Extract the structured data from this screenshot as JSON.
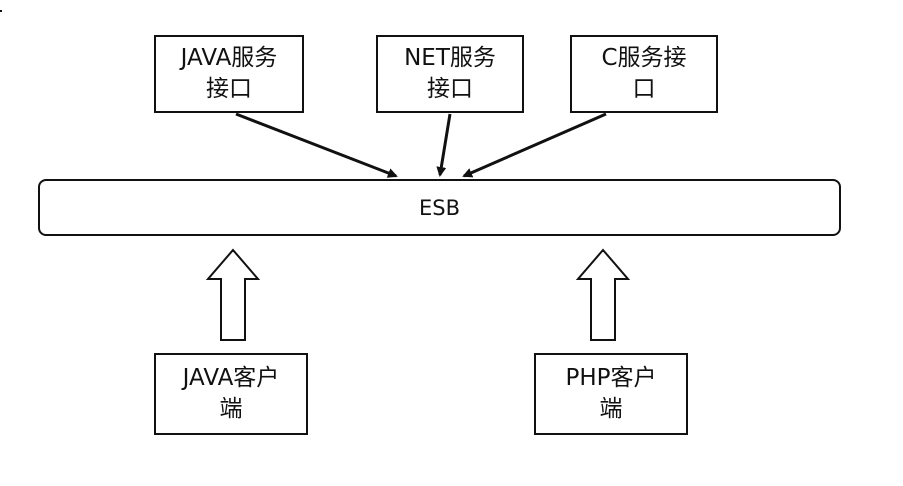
{
  "services": {
    "java": [
      "JAVA服务",
      "接口"
    ],
    "net": [
      "NET服务",
      "接口"
    ],
    "c": [
      "C服务接",
      "口"
    ]
  },
  "bus": {
    "label": "ESB"
  },
  "clients": {
    "java": [
      "JAVA客户",
      "端"
    ],
    "php": [
      "PHP客户",
      "端"
    ]
  },
  "colors": {
    "stroke": "#111111",
    "fill": "#ffffff"
  }
}
